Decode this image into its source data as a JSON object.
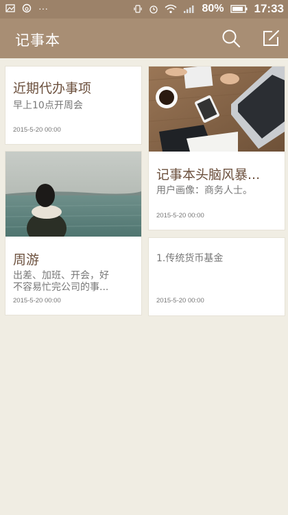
{
  "status_bar": {
    "battery_percent": "80%",
    "time": "17:33",
    "icons": [
      "image-icon",
      "app-icon",
      "more-icon",
      "vibrate-icon",
      "alarm-icon",
      "wifi-icon",
      "signal-icon",
      "battery-icon"
    ]
  },
  "app_bar": {
    "title": "记事本",
    "icons": [
      "search-icon",
      "edit-icon"
    ]
  },
  "notes": [
    {
      "title": "近期代办事项",
      "body": "早上10点开周会",
      "date": "2015-5-20 00:00",
      "has_image": false
    },
    {
      "title": "记事本头脑风暴...",
      "body": "用户画像：商务人士。",
      "date": "2015-5-20 00:00",
      "has_image": true,
      "image": "desk-photo"
    },
    {
      "title": "周游",
      "body": "出差、加班、开会，好不容易忙完公司的事...",
      "date": "2015-5-20 00:00",
      "has_image": true,
      "image": "sea-photo"
    },
    {
      "title": "",
      "body": "1.传统货币基金",
      "date": "2015-5-20 00:00",
      "has_image": false
    }
  ],
  "colors": {
    "status_bar": "#9c8269",
    "app_bar": "#a88e74",
    "background": "#f0ede3",
    "note_title": "#6b4f3c"
  }
}
